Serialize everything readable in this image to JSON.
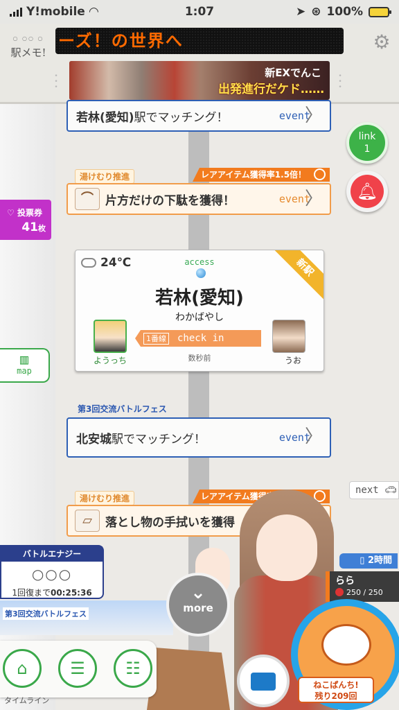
{
  "status_bar": {
    "carrier": "Y!mobile",
    "time": "1:07",
    "battery": "100%"
  },
  "header": {
    "app_logo": "駅メモ!",
    "marquee_text": "ーズ！の世界へ",
    "banner": {
      "line1": "新EXでんこ",
      "line2": "出発進行だケド……"
    }
  },
  "timeline": {
    "matching_top": {
      "station": "若林(愛知)",
      "suffix": "駅でマッチング！",
      "event_label": "event"
    },
    "item_top": {
      "campaign_tag": "湯けむり推進",
      "rare_tag": "レアアイテム獲得率1.5倍！",
      "text": "片方だけの下駄を獲得！",
      "event_label": "event"
    },
    "station_card": {
      "temperature": "24℃",
      "access_label": "access",
      "new_badge": "新駅",
      "station_name": "若林(愛知)",
      "reading": "わかばやし",
      "left_user": "ようっち",
      "line_badge": "1番線",
      "checkin_label": "check in",
      "time_ago": "数秒前",
      "right_user": "うお"
    },
    "matching_mid": {
      "campaign_tag": "第3回交流バトルフェス",
      "station": "北安城",
      "suffix": "駅でマッチング！",
      "event_label": "event"
    },
    "item_bottom": {
      "campaign_tag": "湯けむり推進",
      "rare_tag": "レアアイテム獲得率1.5倍！",
      "text": "落とし物の手拭いを獲得",
      "event_label": "event"
    }
  },
  "side": {
    "link_label": "link",
    "link_count": "1",
    "vote_label": "投票券",
    "vote_count": "41",
    "vote_unit": "枚",
    "map_label": "map",
    "next_label": "next"
  },
  "battle_energy": {
    "title": "バトルエナジー",
    "circles": "○○○",
    "recover_label": "1回復まで",
    "recover_time": "00:25:36"
  },
  "fest_label": "第3回交流バトルフェス",
  "more_label": "more",
  "partner": {
    "time_badge": "2時間",
    "name": "らら",
    "hp": "250 / 250"
  },
  "neko": {
    "line1": "ねこぱんち!",
    "line2": "残り209回"
  },
  "bottom_nav": {
    "timeline_label": "タイムライン"
  },
  "colors": {
    "blue": "#2d5fb5",
    "orange": "#f19c4a",
    "green": "#3aa84a",
    "purple": "#c231c9",
    "red": "#f0424a"
  }
}
